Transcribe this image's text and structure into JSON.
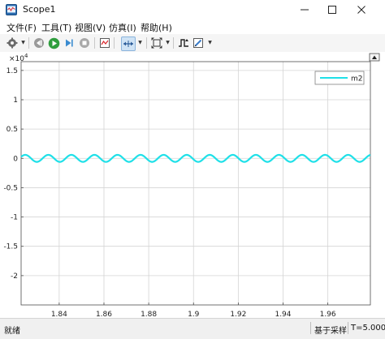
{
  "window": {
    "title": "Scope1",
    "minimize_icon": "minimize-icon",
    "maximize_icon": "maximize-icon",
    "close_icon": "close-icon"
  },
  "menu": [
    "文件(F)",
    "工具(T)",
    "视图(V)",
    "仿真(I)",
    "帮助(H)"
  ],
  "toolbar": [
    "settings-gear-icon",
    "step-back-icon",
    "run-icon",
    "step-forward-icon",
    "stop-icon",
    "highlight-signal-icon",
    "zoom-icon",
    "autoscale-icon",
    "pen-icon"
  ],
  "colors": {
    "signal": "#1fe0e8",
    "grid": "#d4d4d4",
    "axes": "#4d4d4d",
    "background": "#ffffff"
  },
  "chart_data": {
    "type": "line",
    "exponent_label": "×10",
    "exponent_power": "4",
    "xlim": [
      1.823,
      1.979
    ],
    "ylim": [
      -2.5,
      1.65
    ],
    "xticks": [
      1.84,
      1.86,
      1.88,
      1.9,
      1.92,
      1.94,
      1.96
    ],
    "xtick_labels": [
      "1.84",
      "1.86",
      "1.88",
      "1.9",
      "1.92",
      "1.94",
      "1.96"
    ],
    "yticks": [
      1.5,
      1,
      0.5,
      0,
      -0.5,
      -1,
      -1.5,
      -2
    ],
    "ytick_labels": [
      "1.5",
      "1",
      "0.5",
      "0",
      "-0.5",
      "-1",
      "-1.5",
      "-2"
    ],
    "grid": true,
    "legend_position": "top-right",
    "series": [
      {
        "name": "m2",
        "color": "#1fe0e8",
        "amplitude": 0.06,
        "offset": 0,
        "period": 0.0103,
        "phase": 0.5
      }
    ]
  },
  "status": {
    "left": "就绪",
    "sample": "基于采样",
    "time": "T=5.000"
  }
}
